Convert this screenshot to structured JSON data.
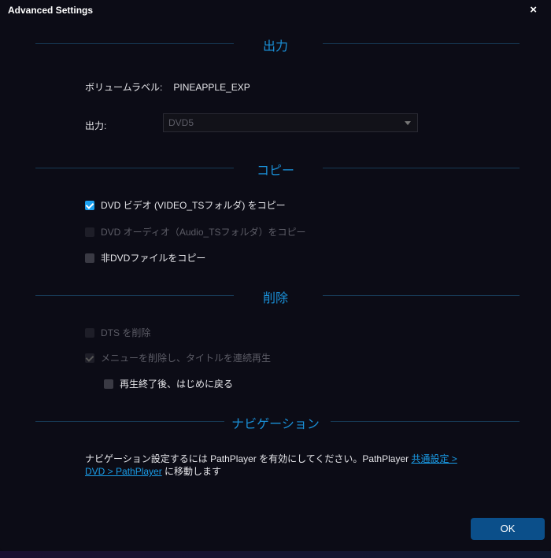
{
  "window": {
    "title": "Advanced Settings",
    "close_label": "×"
  },
  "output": {
    "heading": "出力",
    "volume_label_caption": "ボリュームラベル:",
    "volume_label_value": "PINEAPPLE_EXP",
    "output_caption": "出力:",
    "output_select_value": "DVD5"
  },
  "copy": {
    "heading": "コピー",
    "items": [
      {
        "label": "DVD ビデオ (VIDEO_TSフォルダ) をコピー",
        "checked": true,
        "enabled": true
      },
      {
        "label": "DVD オーディオ（Audio_TSフォルダ）をコピー",
        "checked": false,
        "enabled": false
      },
      {
        "label": "非DVDファイルをコピー",
        "checked": false,
        "enabled": true
      }
    ]
  },
  "remove": {
    "heading": "削除",
    "items": [
      {
        "label": "DTS を削除",
        "checked": false,
        "enabled": false
      },
      {
        "label": "メニューを削除し、タイトルを連続再生",
        "checked": true,
        "enabled": false
      },
      {
        "label": "再生終了後、はじめに戻る",
        "checked": false,
        "enabled": true
      }
    ]
  },
  "navigation": {
    "heading": "ナビゲーション",
    "text_before": "ナビゲーション設定するには PathPlayer を有効にしてください。PathPlayer ",
    "link": "共通設定 > DVD > PathPlayer",
    "text_after": " に移動します"
  },
  "footer": {
    "ok_label": "OK"
  },
  "colors": {
    "accent": "#1a8fd6",
    "ok_button": "#0b4f8a",
    "checkbox_checked": "#1aa0f0"
  }
}
